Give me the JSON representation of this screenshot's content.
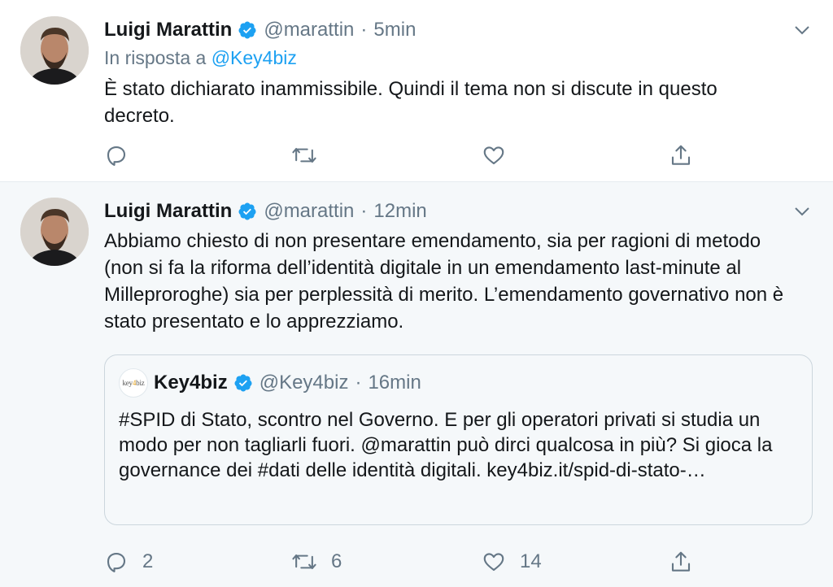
{
  "tweets": [
    {
      "author_name": "Luigi Marattin",
      "handle": "@marattin",
      "separator": "·",
      "time": "5min",
      "reply_prefix": "In risposta a",
      "reply_mention": "@Key4biz",
      "text": "È stato dichiarato inammissibile. Quindi il tema non si discute in questo decreto.",
      "replies": "",
      "retweets": "",
      "likes": ""
    },
    {
      "author_name": "Luigi Marattin",
      "handle": "@marattin",
      "separator": "·",
      "time": "12min",
      "text": "Abbiamo chiesto di non presentare emendamento, sia per ragioni di metodo (non si fa la riforma dell’identità digitale in un emendamento last-minute al Milleproroghe) sia per perplessità di merito. L’emendamento governativo non è stato presentato e lo apprezziamo.",
      "replies": "2",
      "retweets": "6",
      "likes": "14",
      "quote": {
        "logo_text_main": "key",
        "logo_text_accent": "4",
        "logo_text_end": "biz",
        "author_name": "Key4biz",
        "handle": "@Key4biz",
        "separator": "·",
        "time": "16min",
        "text": "#SPID di Stato, scontro nel Governo. E per gli operatori privati si studia un modo per non tagliarli fuori. @marattin può dirci qualcosa in più? Si gioca la governance dei #dati delle identità digitali. key4biz.it/spid-di-stato-…"
      }
    }
  ],
  "icons": {
    "verified_color": "#1da1f2",
    "action_color": "#657786"
  }
}
